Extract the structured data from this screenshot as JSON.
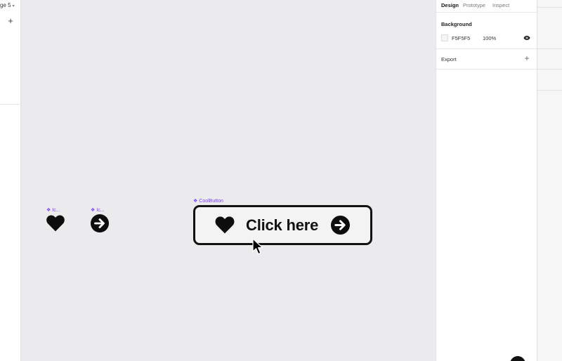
{
  "left_panel": {
    "page_name": "ge 5",
    "add_page_symbol": "+"
  },
  "canvas": {
    "background_color": "#EBEBED",
    "components": [
      {
        "label": "Ic...",
        "icon": "heart-icon"
      },
      {
        "label": "Ic...",
        "icon": "arrow-circle-right-icon"
      }
    ],
    "cool_button": {
      "frame_label": "CoolButton",
      "text": "Click here",
      "left_icon": "heart-icon",
      "right_icon": "arrow-circle-right-icon"
    },
    "component_symbol": "❖",
    "accent_color": "#7B3FF2"
  },
  "right_panel": {
    "tabs": [
      "Design",
      "Prototype",
      "Inspect"
    ],
    "active_tab": "Design",
    "background_section": {
      "title": "Background",
      "hex": "F5F5F5",
      "opacity": "100%",
      "visibility_icon": "eye-icon"
    },
    "export_section": {
      "title": "Export",
      "add_symbol": "+"
    }
  }
}
